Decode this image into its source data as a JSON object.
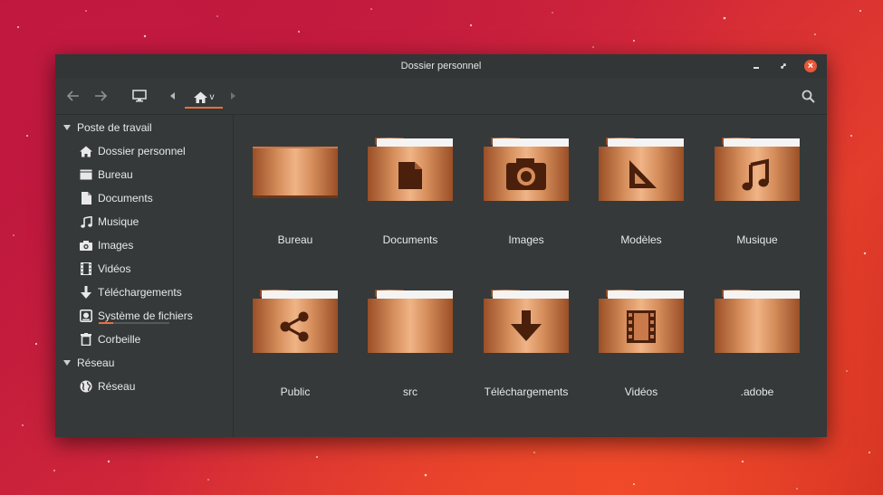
{
  "window": {
    "title": "Dossier personnel",
    "controls": {
      "minimize": "–",
      "maximize": "⤢",
      "close": "×"
    }
  },
  "toolbar": {
    "back_icon": "arrow-left-icon",
    "forward_icon": "arrow-right-icon",
    "computer_icon": "monitor-icon",
    "path_home_icon": "home-icon",
    "path_dropdown": "v",
    "search_icon": "search-icon"
  },
  "sidebar": {
    "sections": [
      {
        "label": "Poste de travail",
        "items": [
          {
            "label": "Dossier personnel",
            "icon": "home-icon"
          },
          {
            "label": "Bureau",
            "icon": "desktop-icon"
          },
          {
            "label": "Documents",
            "icon": "document-icon"
          },
          {
            "label": "Musique",
            "icon": "music-icon"
          },
          {
            "label": "Images",
            "icon": "camera-icon"
          },
          {
            "label": "Vidéos",
            "icon": "film-icon"
          },
          {
            "label": "Téléchargements",
            "icon": "download-icon"
          },
          {
            "label": "Système de fichiers",
            "icon": "drive-icon",
            "usage_fraction": 0.2
          },
          {
            "label": "Corbeille",
            "icon": "trash-icon"
          }
        ]
      },
      {
        "label": "Réseau",
        "items": [
          {
            "label": "Réseau",
            "icon": "globe-icon"
          }
        ]
      }
    ]
  },
  "files": [
    {
      "label": "Bureau",
      "icon": "desktop-folder"
    },
    {
      "label": "Documents",
      "icon": "document"
    },
    {
      "label": "Images",
      "icon": "camera"
    },
    {
      "label": "Modèles",
      "icon": "set-square"
    },
    {
      "label": "Musique",
      "icon": "music-note"
    },
    {
      "label": "Public",
      "icon": "share"
    },
    {
      "label": "src",
      "icon": "plain"
    },
    {
      "label": "Téléchargements",
      "icon": "download-arrow"
    },
    {
      "label": "Vidéos",
      "icon": "film"
    },
    {
      "label": ".adobe",
      "icon": "plain"
    }
  ],
  "colors": {
    "window_bg": "#35393a",
    "accent": "#e8703a",
    "copper_light": "#e6a474",
    "copper_dark": "#a6582c",
    "close_button": "#e8573a"
  }
}
